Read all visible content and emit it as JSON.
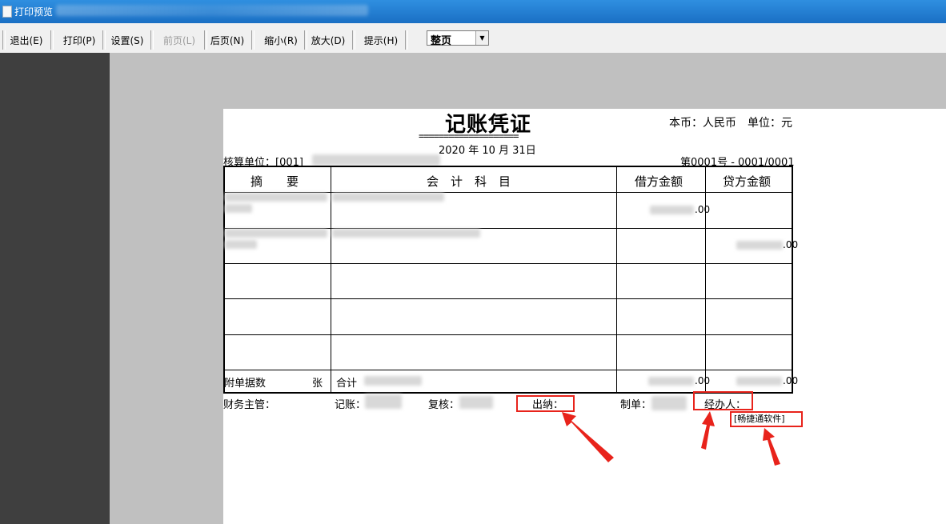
{
  "window": {
    "title": "打印预览"
  },
  "toolbar": {
    "buttons": [
      {
        "label": "退出(E)",
        "enabled": true
      },
      {
        "label": "打印(P)",
        "enabled": true
      },
      {
        "label": "设置(S)",
        "enabled": true
      },
      {
        "label": "前页(L)",
        "enabled": false
      },
      {
        "label": "后页(N)",
        "enabled": true
      },
      {
        "label": "缩小(R)",
        "enabled": true
      },
      {
        "label": "放大(D)",
        "enabled": true
      },
      {
        "label": "提示(H)",
        "enabled": true
      }
    ],
    "zoom_select": {
      "value": "整页"
    }
  },
  "voucher": {
    "title": "记账凭证",
    "currency_unit": "本币：人民币　单位：元",
    "title_underline": "====================",
    "date": "2020 年  10  月 31日",
    "accounting_unit": "核算单位：[001]",
    "voucher_no": "第0001号 - 0001/0001",
    "headers": {
      "summary": "摘　　要",
      "account": "会　计　科　目",
      "debit": "借方金额",
      "credit": "贷方金额"
    },
    "rows": [
      {
        "debit": ".00"
      },
      {
        "credit": ".00"
      }
    ],
    "footer": {
      "attachments_label": "附单据数",
      "attachments_unit": "张",
      "total_label": "合计",
      "debit_total": ".00",
      "credit_total": ".00"
    },
    "signatures": {
      "supervisor": "财务主管：",
      "bookkeeper": "记账：",
      "reviewer": "复核：",
      "cashier": "出纳：",
      "preparer": "制单：",
      "handler": "经办人：",
      "software_tag": "[畅捷通软件]"
    }
  },
  "colors": {
    "titlebar": "#1a6fc4",
    "toolbar": "#f0f0f0",
    "left_panel": "#3f3f3f",
    "preview_bg": "#c0c0c0",
    "annotation_red": "#e8231b"
  }
}
